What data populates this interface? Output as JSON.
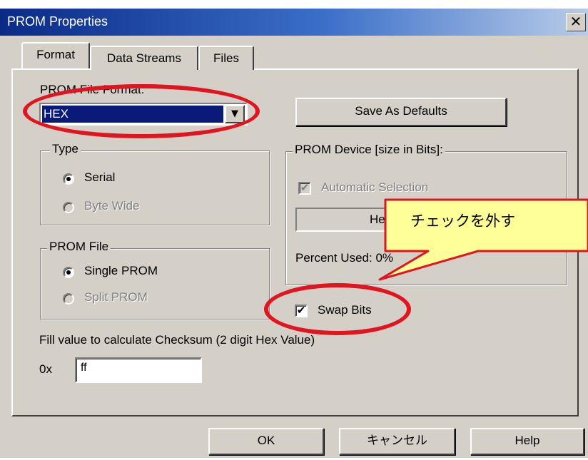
{
  "window": {
    "title": "PROM Properties",
    "close_glyph": "✕"
  },
  "tabs": [
    {
      "label": "Format"
    },
    {
      "label": "Data Streams"
    },
    {
      "label": "Files"
    }
  ],
  "prom_file_format": {
    "label": "PROM File Format:",
    "value": "HEX"
  },
  "save_defaults": {
    "label": "Save As Defaults"
  },
  "type_group": {
    "legend": "Type",
    "options": [
      {
        "label": "Serial",
        "selected": true,
        "enabled": true
      },
      {
        "label": "Byte Wide",
        "selected": false,
        "enabled": false
      }
    ]
  },
  "prom_file_group": {
    "legend": "PROM File",
    "options": [
      {
        "label": "Single PROM",
        "selected": true,
        "enabled": true
      },
      {
        "label": "Split PROM",
        "selected": false,
        "enabled": false
      }
    ]
  },
  "device_group": {
    "legend": "PROM Device [size in Bits]:",
    "automatic_selection": {
      "label": "Automatic Selection",
      "checked": true,
      "enabled": false
    },
    "device_field_value": "He",
    "percent_used": "Percent Used: 0%"
  },
  "swap_bits": {
    "label": "Swap Bits",
    "checked": true
  },
  "checksum": {
    "label": "Fill value to calculate Checksum (2 digit Hex Value)",
    "prefix": "0x",
    "value": "ff"
  },
  "buttons": {
    "ok": "OK",
    "cancel": "キャンセル",
    "help": "Help"
  },
  "callout": {
    "text": "チェックを外す"
  },
  "colors": {
    "titlebar_start": "#0a2a86",
    "dialog_face": "#d4d0c8",
    "selection": "#0a1a78",
    "annotation_red": "#e0151f",
    "callout_fill": "#ffff99"
  },
  "icons": {
    "dropdown_arrow": "▼",
    "check": "✔"
  }
}
